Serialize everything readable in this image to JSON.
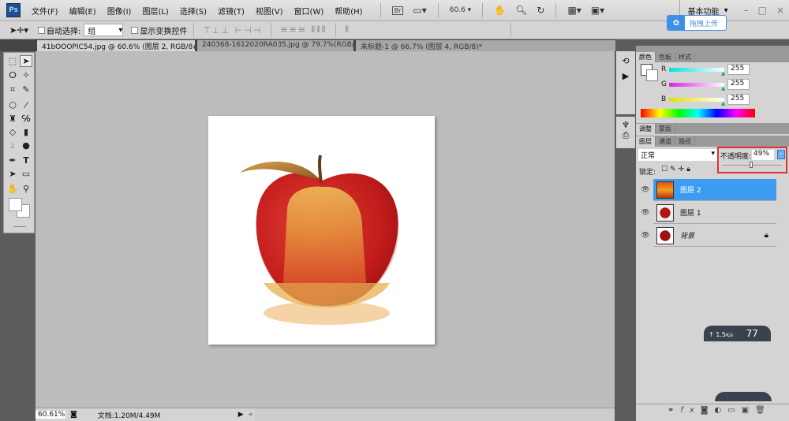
{
  "app": {
    "logo": "Ps"
  },
  "menu": [
    "文件(F)",
    "编辑(E)",
    "图像(I)",
    "图层(L)",
    "选择(S)",
    "滤镜(T)",
    "视图(V)",
    "窗口(W)",
    "帮助(H)"
  ],
  "menubar": {
    "bridge": "Br",
    "zoom": "60.6",
    "workspace": "基本功能"
  },
  "upload_button": "拖拽上传",
  "options": {
    "auto_select_label": "自动选择:",
    "auto_select_value": "组",
    "show_transform_label": "显示变换控件"
  },
  "tabs": [
    "41bOOOPIC54.jpg @ 60.6% (图层 2, RGB/8#) *",
    "240368-1612020RA035.jpg @ 79.7%(RGB/8#) *",
    "未标题-1 @ 66.7% (图层 4, RGB/8)*"
  ],
  "status": {
    "zoom": "60.61%",
    "doc": "文档:1.20M/4.49M"
  },
  "color_panel": {
    "tabs": [
      "颜色",
      "色板",
      "样式"
    ],
    "channels": [
      {
        "label": "R",
        "value": "255",
        "color": "#00e0e0"
      },
      {
        "label": "G",
        "value": "255",
        "color": "#e020e0"
      },
      {
        "label": "B",
        "value": "255",
        "color": "#e0e000"
      }
    ]
  },
  "adjust_panel": {
    "tabs": [
      "调整",
      "蒙版"
    ]
  },
  "layers_panel": {
    "tabs": [
      "图层",
      "通道",
      "路径"
    ],
    "blend_mode": "正常",
    "opacity_label": "不透明度:",
    "opacity": "49%",
    "opacity_percent": 49,
    "lock_label": "锁定:",
    "layers": [
      {
        "name": "图层 2",
        "selected": true
      },
      {
        "name": "图层 1",
        "selected": false
      },
      {
        "name": "背景",
        "selected": false,
        "locked": true
      }
    ]
  },
  "net_widget": {
    "speed": "1.5",
    "unit": "K/s",
    "value": "77"
  },
  "colors": {
    "selection": "#3d9cf0",
    "highlight": "#e03030"
  }
}
